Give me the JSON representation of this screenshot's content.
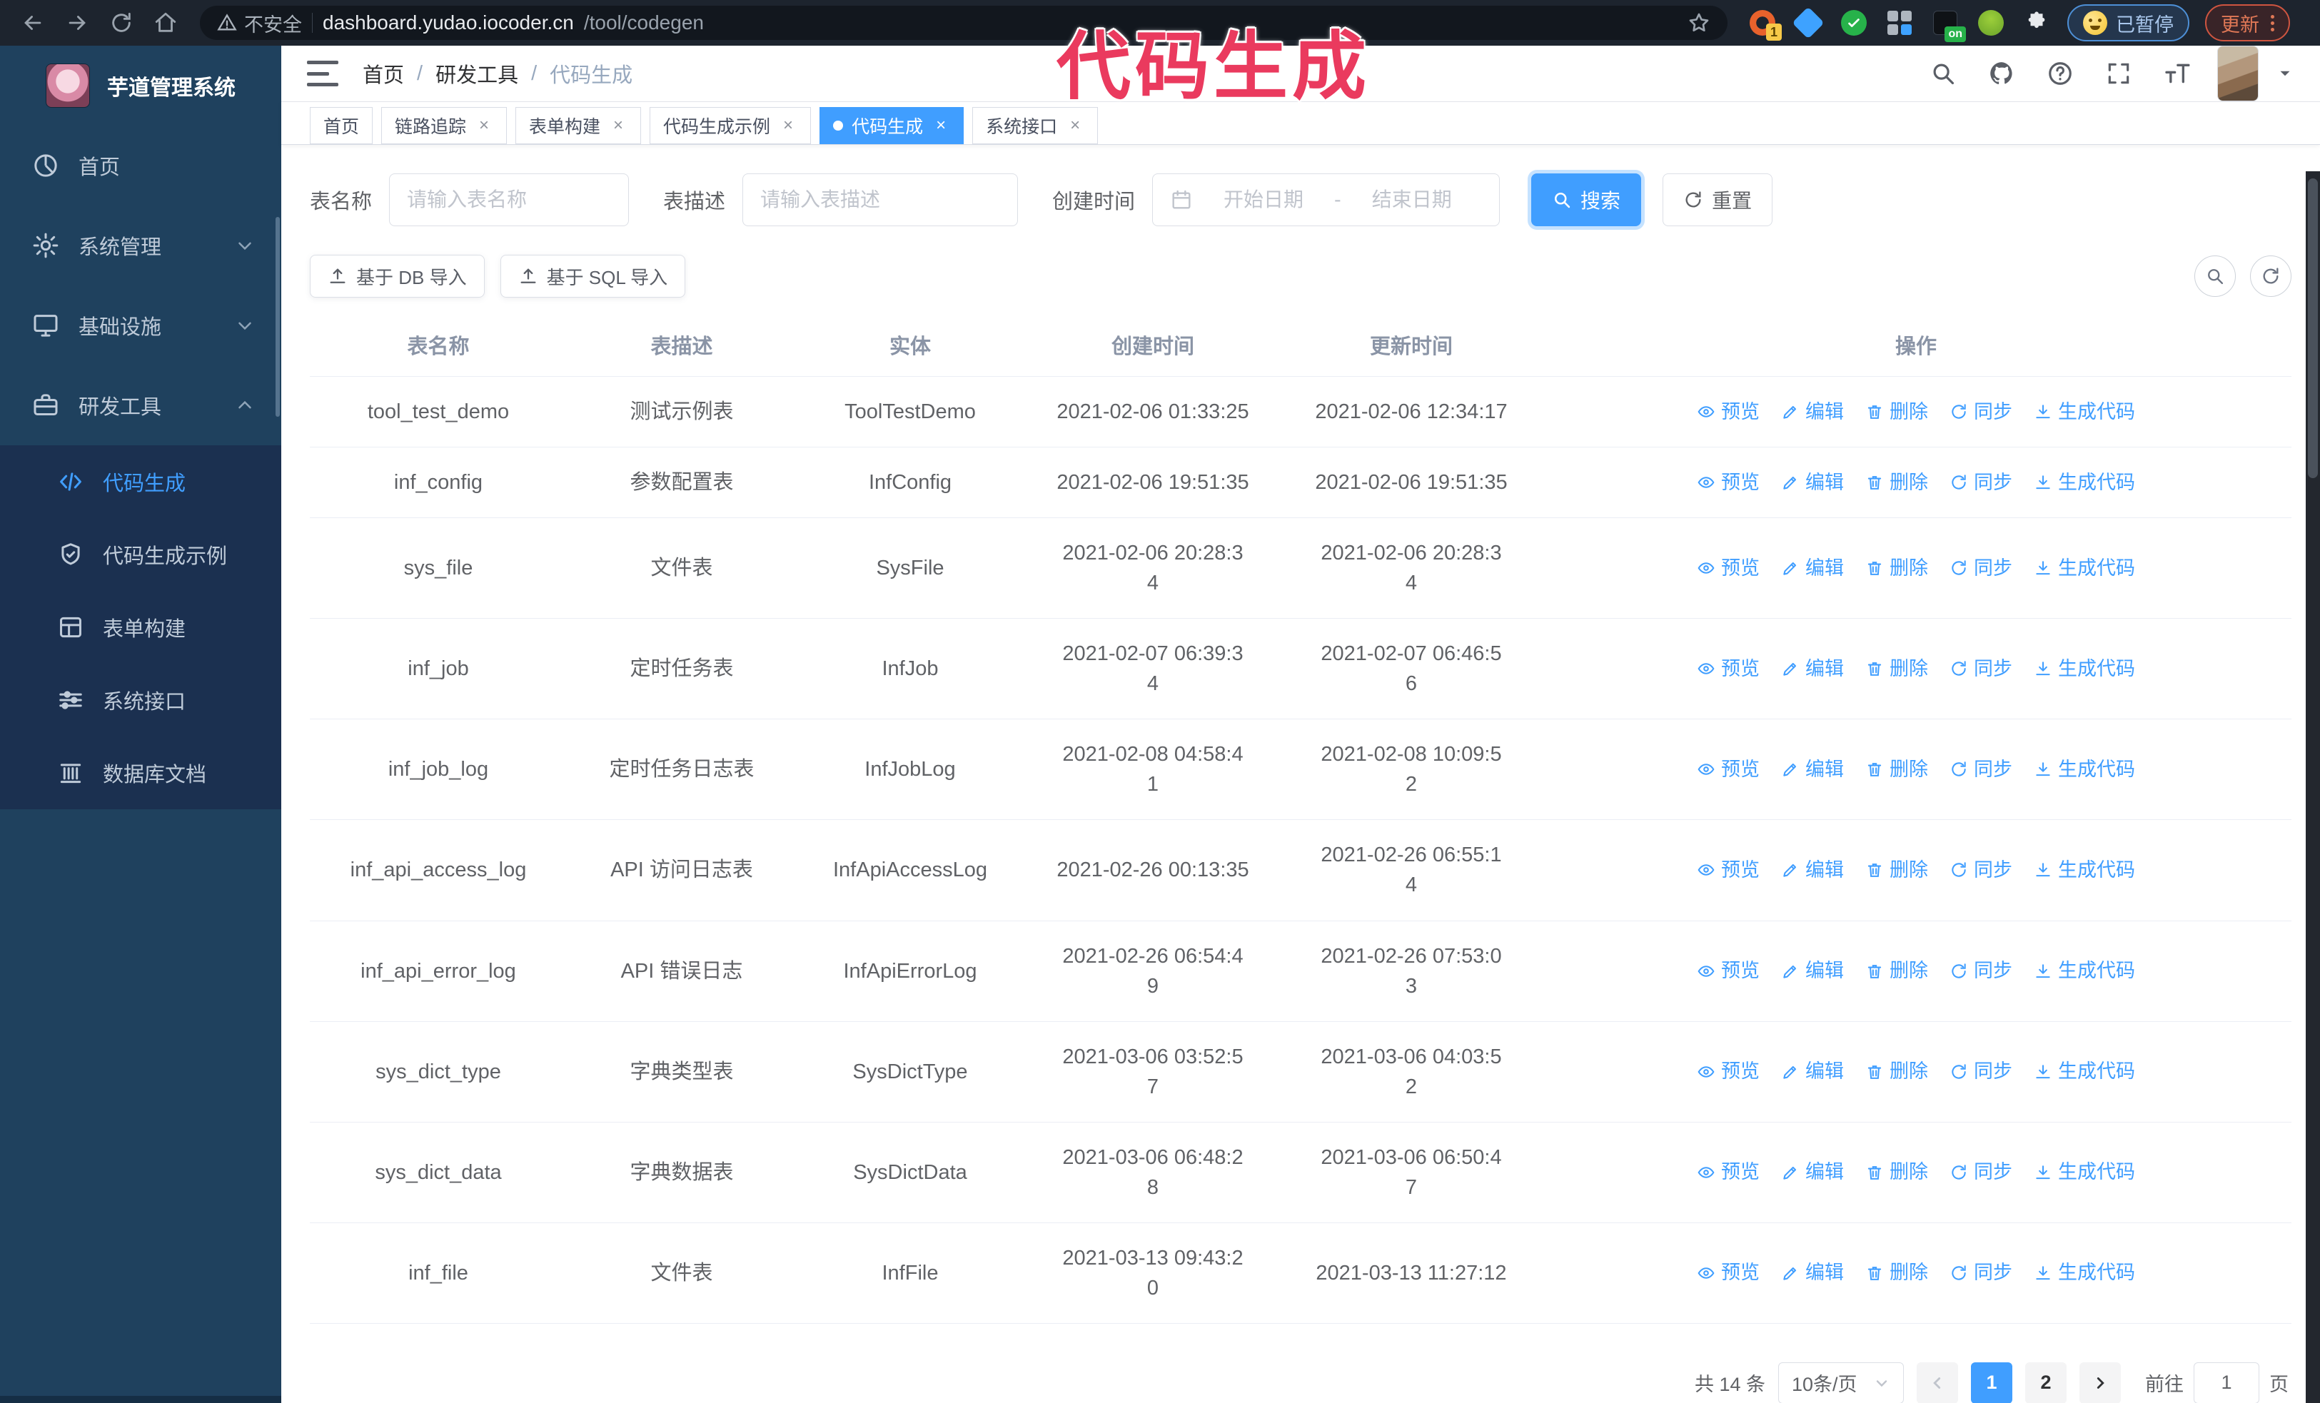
{
  "colors": {
    "accent": "#409eff",
    "sidebar_bg": "#1f415e",
    "submenu_bg": "#1b3050",
    "overlay_text": "#ea3a5e",
    "browser_bg": "#1d242e"
  },
  "overlay": {
    "text": "代码生成"
  },
  "browser": {
    "security_label": "不安全",
    "url_host": "dashboard.yudao.iocoder.cn",
    "url_path": "/tool/codegen",
    "ext_badge_1": "1",
    "ext_badge_on": "on",
    "paused_badge": "已暂停",
    "update_button": "更新"
  },
  "sidebar": {
    "title": "芋道管理系统",
    "menu": [
      {
        "label": "首页",
        "icon": "dashboard-icon"
      },
      {
        "label": "系统管理",
        "icon": "gear-icon"
      },
      {
        "label": "基础设施",
        "icon": "monitor-icon"
      },
      {
        "label": "研发工具",
        "icon": "toolbox-icon"
      }
    ],
    "submenu": [
      {
        "label": "代码生成",
        "icon": "code-icon",
        "active": true
      },
      {
        "label": "代码生成示例",
        "icon": "shield-check-icon"
      },
      {
        "label": "表单构建",
        "icon": "form-icon"
      },
      {
        "label": "系统接口",
        "icon": "sliders-icon"
      },
      {
        "label": "数据库文档",
        "icon": "columns-icon"
      }
    ]
  },
  "header": {
    "breadcrumb": [
      "首页",
      "研发工具",
      "代码生成"
    ],
    "separator": "/"
  },
  "tabs": [
    {
      "label": "首页",
      "closable": false,
      "active": false
    },
    {
      "label": "链路追踪",
      "closable": true,
      "active": false
    },
    {
      "label": "表单构建",
      "closable": true,
      "active": false
    },
    {
      "label": "代码生成示例",
      "closable": true,
      "active": false
    },
    {
      "label": "代码生成",
      "closable": true,
      "active": true
    },
    {
      "label": "系统接口",
      "closable": true,
      "active": false
    }
  ],
  "search_form": {
    "table_name_label": "表名称",
    "table_name_placeholder": "请输入表名称",
    "table_desc_label": "表描述",
    "table_desc_placeholder": "请输入表描述",
    "create_time_label": "创建时间",
    "date_start_placeholder": "开始日期",
    "date_separator": "-",
    "date_end_placeholder": "结束日期",
    "search_button": "搜索",
    "reset_button": "重置"
  },
  "toolbar": {
    "import_db_button": "基于 DB 导入",
    "import_sql_button": "基于 SQL 导入"
  },
  "table": {
    "columns": [
      "表名称",
      "表描述",
      "实体",
      "创建时间",
      "更新时间",
      "操作"
    ],
    "actions": [
      {
        "label": "预览",
        "icon": "eye-icon"
      },
      {
        "label": "编辑",
        "icon": "edit-icon"
      },
      {
        "label": "删除",
        "icon": "delete-icon"
      },
      {
        "label": "同步",
        "icon": "sync-icon"
      },
      {
        "label": "生成代码",
        "icon": "download-icon"
      }
    ],
    "rows": [
      {
        "name": "tool_test_demo",
        "desc": "测试示例表",
        "entity": "ToolTestDemo",
        "created": "2021-02-06 01:33:25",
        "updated": "2021-02-06 12:34:17"
      },
      {
        "name": "inf_config",
        "desc": "参数配置表",
        "entity": "InfConfig",
        "created": "2021-02-06 19:51:35",
        "updated": "2021-02-06 19:51:35"
      },
      {
        "name": "sys_file",
        "desc": "文件表",
        "entity": "SysFile",
        "created": "2021-02-06 20:28:3\n4",
        "updated": "2021-02-06 20:28:3\n4"
      },
      {
        "name": "inf_job",
        "desc": "定时任务表",
        "entity": "InfJob",
        "created": "2021-02-07 06:39:3\n4",
        "updated": "2021-02-07 06:46:5\n6"
      },
      {
        "name": "inf_job_log",
        "desc": "定时任务日志表",
        "entity": "InfJobLog",
        "created": "2021-02-08 04:58:4\n1",
        "updated": "2021-02-08 10:09:5\n2"
      },
      {
        "name": "inf_api_access_log",
        "desc": "API 访问日志表",
        "entity": "InfApiAccessLog",
        "created": "2021-02-26 00:13:35",
        "updated": "2021-02-26 06:55:1\n4"
      },
      {
        "name": "inf_api_error_log",
        "desc": "API 错误日志",
        "entity": "InfApiErrorLog",
        "created": "2021-02-26 06:54:4\n9",
        "updated": "2021-02-26 07:53:0\n3"
      },
      {
        "name": "sys_dict_type",
        "desc": "字典类型表",
        "entity": "SysDictType",
        "created": "2021-03-06 03:52:5\n7",
        "updated": "2021-03-06 04:03:5\n2"
      },
      {
        "name": "sys_dict_data",
        "desc": "字典数据表",
        "entity": "SysDictData",
        "created": "2021-03-06 06:48:2\n8",
        "updated": "2021-03-06 06:50:4\n7"
      },
      {
        "name": "inf_file",
        "desc": "文件表",
        "entity": "InfFile",
        "created": "2021-03-13 09:43:2\n0",
        "updated": "2021-03-13 11:27:12"
      }
    ]
  },
  "pagination": {
    "total_text": "共 14 条",
    "page_size_text": "10条/页",
    "page_1": "1",
    "page_2": "2",
    "active_page": "1",
    "goto_label": "前往",
    "goto_value": "1",
    "goto_suffix": "页"
  }
}
